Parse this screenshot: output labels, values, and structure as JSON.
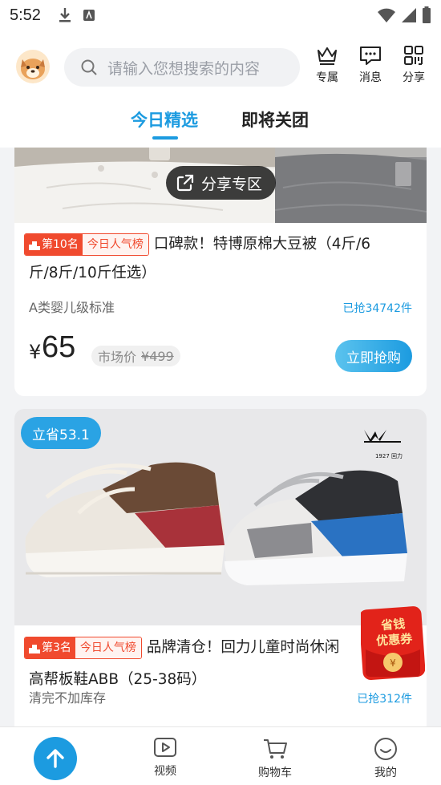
{
  "status_bar": {
    "time": "5:52"
  },
  "header": {
    "search_placeholder": "请输入您想搜索的内容",
    "buttons": [
      {
        "label": "专属",
        "icon": "crown-icon"
      },
      {
        "label": "消息",
        "icon": "message-icon"
      },
      {
        "label": "分享",
        "icon": "qrcode-icon"
      }
    ],
    "tabs": [
      {
        "label": "今日精选",
        "active": true
      },
      {
        "label": "即将关团",
        "active": false
      }
    ]
  },
  "products": [
    {
      "share_label": "分享专区",
      "rank": "第10名",
      "rank_list": "今日人气榜",
      "title_line1": "口碑款！特博原棉大豆被（4斤/6",
      "title_line2": "斤/8斤/10斤任选）",
      "subtitle": "A类婴儿级标准",
      "sold": "已抢34742件",
      "currency": "¥",
      "price": "65",
      "market_label": "市场价",
      "market_price": "¥499",
      "buy_label": "立即抢购"
    },
    {
      "save_badge": "立省53.1",
      "brand_logo_text": "1927 回力",
      "rank": "第3名",
      "rank_list": "今日人气榜",
      "title_line1": "品牌清仓！回力儿童时尚休闲",
      "title_line2": "高帮板鞋ABB（25-38码）",
      "subtitle": "清完不加库存",
      "sold": "已抢312件"
    }
  ],
  "coupon": {
    "line1": "省钱",
    "line2": "优惠券"
  },
  "bottom_nav": [
    {
      "label": "视频",
      "icon": "video-icon"
    },
    {
      "label": "购物车",
      "icon": "cart-icon"
    },
    {
      "label": "我的",
      "icon": "profile-icon"
    }
  ],
  "colors": {
    "accent": "#1c9be0",
    "rank_red": "#f04a2e"
  }
}
